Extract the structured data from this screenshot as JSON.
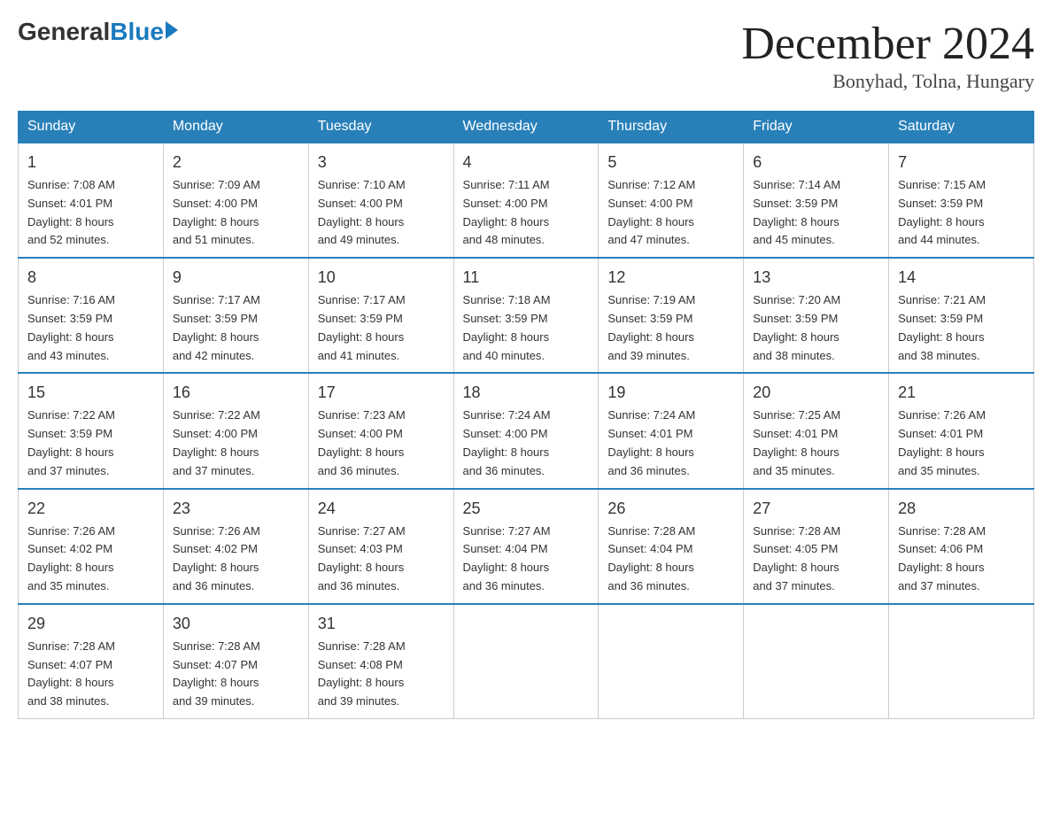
{
  "header": {
    "logo_general": "General",
    "logo_blue": "Blue",
    "month_title": "December 2024",
    "location": "Bonyhad, Tolna, Hungary"
  },
  "weekdays": [
    "Sunday",
    "Monday",
    "Tuesday",
    "Wednesday",
    "Thursday",
    "Friday",
    "Saturday"
  ],
  "weeks": [
    [
      {
        "day": "1",
        "sunrise": "7:08 AM",
        "sunset": "4:01 PM",
        "daylight": "8 hours and 52 minutes."
      },
      {
        "day": "2",
        "sunrise": "7:09 AM",
        "sunset": "4:00 PM",
        "daylight": "8 hours and 51 minutes."
      },
      {
        "day": "3",
        "sunrise": "7:10 AM",
        "sunset": "4:00 PM",
        "daylight": "8 hours and 49 minutes."
      },
      {
        "day": "4",
        "sunrise": "7:11 AM",
        "sunset": "4:00 PM",
        "daylight": "8 hours and 48 minutes."
      },
      {
        "day": "5",
        "sunrise": "7:12 AM",
        "sunset": "4:00 PM",
        "daylight": "8 hours and 47 minutes."
      },
      {
        "day": "6",
        "sunrise": "7:14 AM",
        "sunset": "3:59 PM",
        "daylight": "8 hours and 45 minutes."
      },
      {
        "day": "7",
        "sunrise": "7:15 AM",
        "sunset": "3:59 PM",
        "daylight": "8 hours and 44 minutes."
      }
    ],
    [
      {
        "day": "8",
        "sunrise": "7:16 AM",
        "sunset": "3:59 PM",
        "daylight": "8 hours and 43 minutes."
      },
      {
        "day": "9",
        "sunrise": "7:17 AM",
        "sunset": "3:59 PM",
        "daylight": "8 hours and 42 minutes."
      },
      {
        "day": "10",
        "sunrise": "7:17 AM",
        "sunset": "3:59 PM",
        "daylight": "8 hours and 41 minutes."
      },
      {
        "day": "11",
        "sunrise": "7:18 AM",
        "sunset": "3:59 PM",
        "daylight": "8 hours and 40 minutes."
      },
      {
        "day": "12",
        "sunrise": "7:19 AM",
        "sunset": "3:59 PM",
        "daylight": "8 hours and 39 minutes."
      },
      {
        "day": "13",
        "sunrise": "7:20 AM",
        "sunset": "3:59 PM",
        "daylight": "8 hours and 38 minutes."
      },
      {
        "day": "14",
        "sunrise": "7:21 AM",
        "sunset": "3:59 PM",
        "daylight": "8 hours and 38 minutes."
      }
    ],
    [
      {
        "day": "15",
        "sunrise": "7:22 AM",
        "sunset": "3:59 PM",
        "daylight": "8 hours and 37 minutes."
      },
      {
        "day": "16",
        "sunrise": "7:22 AM",
        "sunset": "4:00 PM",
        "daylight": "8 hours and 37 minutes."
      },
      {
        "day": "17",
        "sunrise": "7:23 AM",
        "sunset": "4:00 PM",
        "daylight": "8 hours and 36 minutes."
      },
      {
        "day": "18",
        "sunrise": "7:24 AM",
        "sunset": "4:00 PM",
        "daylight": "8 hours and 36 minutes."
      },
      {
        "day": "19",
        "sunrise": "7:24 AM",
        "sunset": "4:01 PM",
        "daylight": "8 hours and 36 minutes."
      },
      {
        "day": "20",
        "sunrise": "7:25 AM",
        "sunset": "4:01 PM",
        "daylight": "8 hours and 35 minutes."
      },
      {
        "day": "21",
        "sunrise": "7:26 AM",
        "sunset": "4:01 PM",
        "daylight": "8 hours and 35 minutes."
      }
    ],
    [
      {
        "day": "22",
        "sunrise": "7:26 AM",
        "sunset": "4:02 PM",
        "daylight": "8 hours and 35 minutes."
      },
      {
        "day": "23",
        "sunrise": "7:26 AM",
        "sunset": "4:02 PM",
        "daylight": "8 hours and 36 minutes."
      },
      {
        "day": "24",
        "sunrise": "7:27 AM",
        "sunset": "4:03 PM",
        "daylight": "8 hours and 36 minutes."
      },
      {
        "day": "25",
        "sunrise": "7:27 AM",
        "sunset": "4:04 PM",
        "daylight": "8 hours and 36 minutes."
      },
      {
        "day": "26",
        "sunrise": "7:28 AM",
        "sunset": "4:04 PM",
        "daylight": "8 hours and 36 minutes."
      },
      {
        "day": "27",
        "sunrise": "7:28 AM",
        "sunset": "4:05 PM",
        "daylight": "8 hours and 37 minutes."
      },
      {
        "day": "28",
        "sunrise": "7:28 AM",
        "sunset": "4:06 PM",
        "daylight": "8 hours and 37 minutes."
      }
    ],
    [
      {
        "day": "29",
        "sunrise": "7:28 AM",
        "sunset": "4:07 PM",
        "daylight": "8 hours and 38 minutes."
      },
      {
        "day": "30",
        "sunrise": "7:28 AM",
        "sunset": "4:07 PM",
        "daylight": "8 hours and 39 minutes."
      },
      {
        "day": "31",
        "sunrise": "7:28 AM",
        "sunset": "4:08 PM",
        "daylight": "8 hours and 39 minutes."
      },
      null,
      null,
      null,
      null
    ]
  ],
  "labels": {
    "sunrise": "Sunrise:",
    "sunset": "Sunset:",
    "daylight": "Daylight:"
  }
}
